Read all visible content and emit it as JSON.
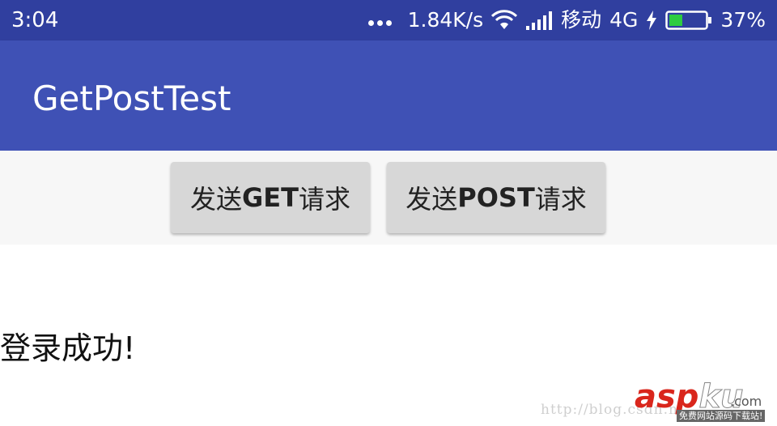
{
  "status_bar": {
    "time": "3:04",
    "net_speed": "1.84K/s",
    "carrier": "移动",
    "network": "4G",
    "battery_percent_label": "37%",
    "battery_level": 0.37,
    "icons": [
      "more-dots-icon",
      "wifi-icon",
      "signal-icon",
      "charging-icon",
      "battery-icon"
    ]
  },
  "app_bar": {
    "title": "GetPostTest"
  },
  "buttons": {
    "get": {
      "prefix": "发送",
      "bold": "GET",
      "suffix": "请求"
    },
    "post": {
      "prefix": "发送",
      "bold": "POST",
      "suffix": "请求"
    }
  },
  "content": {
    "result_text": "登录成功!"
  },
  "watermark": {
    "url": "http://blog.csdn.n",
    "logo_asp": "asp",
    "logo_ku": "ku",
    "logo_com": ".com",
    "logo_sub": "免费网站源码下载站!"
  },
  "colors": {
    "status_bar": "#303f9f",
    "app_bar": "#3f51b5",
    "button_bg": "#d7d7d7",
    "battery_green": "#2ecc40",
    "logo_red": "#d9261c"
  }
}
